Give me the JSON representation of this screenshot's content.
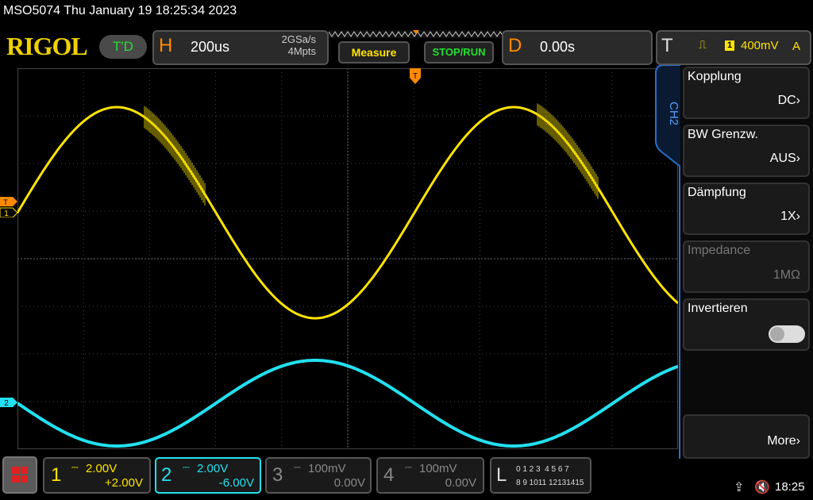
{
  "title": "MSO5074  Thu January 19 18:25:34 2023",
  "logo": "RIGOL",
  "td_button": "T'D",
  "horizontal": {
    "letter": "H",
    "timebase": "200us",
    "sample_rate": "2GSa/s",
    "memory_depth": "4Mpts"
  },
  "buttons": {
    "measure": "Measure",
    "stop_run": "STOP/RUN"
  },
  "delay": {
    "letter": "D",
    "value": "0.00s"
  },
  "trigger": {
    "letter": "T",
    "slope_icon": "rising-edge-icon",
    "source": "1",
    "level": "400mV",
    "mode": "A"
  },
  "menu": {
    "tab": "CH2",
    "items": [
      {
        "label": "Kopplung",
        "value": "DC",
        "enabled": true
      },
      {
        "label": "BW Grenzw.",
        "value": "AUS",
        "enabled": true
      },
      {
        "label": "Dämpfung",
        "value": "1X",
        "enabled": true
      },
      {
        "label": "Impedance",
        "value": "1MΩ",
        "enabled": false
      },
      {
        "label": "Invertieren",
        "value": "",
        "enabled": true
      },
      {
        "label": "More",
        "value": "",
        "enabled": true
      }
    ],
    "invert_toggle": false
  },
  "channels": [
    {
      "num": "1",
      "scale": "2.00V",
      "offset": "+2.00V",
      "color": "#ffe400",
      "active": true
    },
    {
      "num": "2",
      "scale": "2.00V",
      "offset": "-6.00V",
      "color": "#22e0f0",
      "active": true
    },
    {
      "num": "3",
      "scale": "100mV",
      "offset": "0.00V",
      "color": "#888888",
      "active": false
    },
    {
      "num": "4",
      "scale": "100mV",
      "offset": "0.00V",
      "color": "#888888",
      "active": false
    }
  ],
  "logic": {
    "letter": "L",
    "row1": "0 1 2 3  4 5 6 7",
    "row2": "8 9 1011 12131415"
  },
  "status": {
    "time": "18:25"
  },
  "markers": {
    "trigger_level": "T",
    "ch1": "1",
    "ch2": "2"
  },
  "colors": {
    "ch1": "#ffe400",
    "ch2": "#22e0f0",
    "trigger": "#ff8a00",
    "menu_accent": "#2a6ec8"
  }
}
